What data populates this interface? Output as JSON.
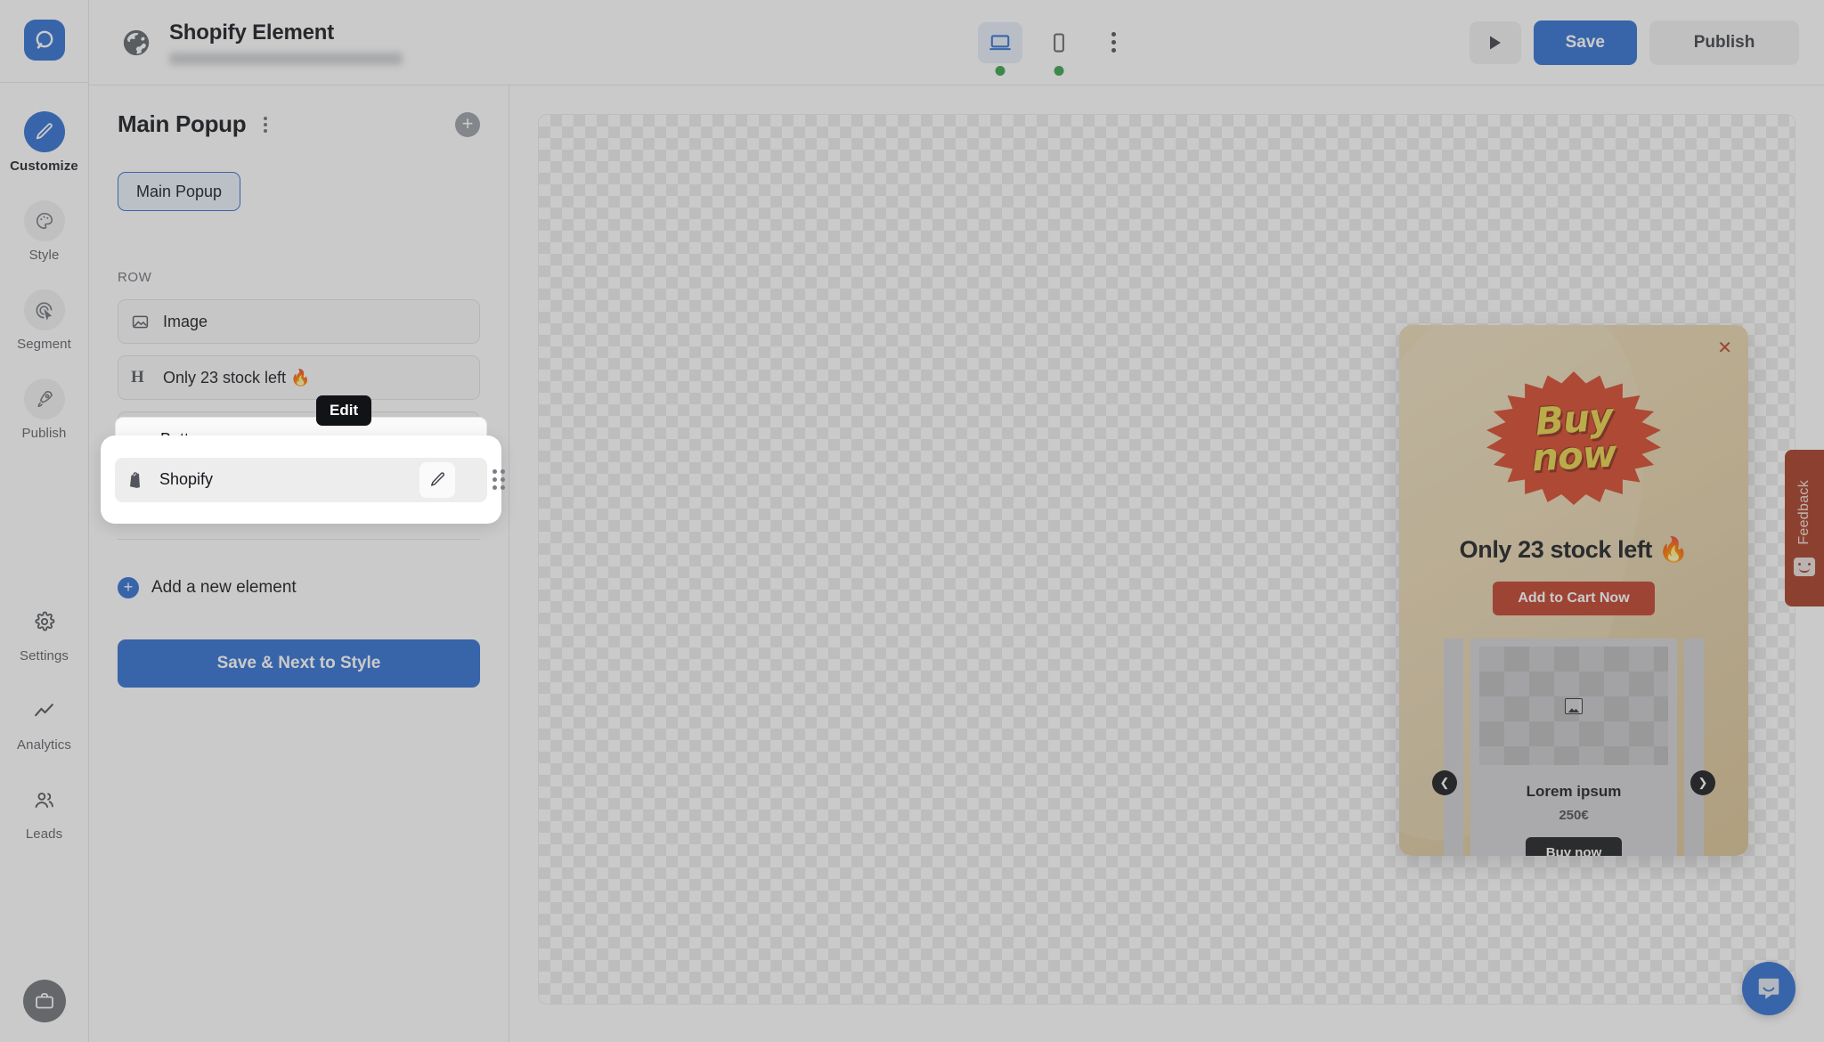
{
  "app": {
    "brand_color": "#2f6fd0",
    "logo_icon": "platform-logo-icon"
  },
  "rail": {
    "items": [
      {
        "label": "Customize",
        "icon": "pencil-icon",
        "active": true
      },
      {
        "label": "Style",
        "icon": "palette-icon",
        "active": false
      },
      {
        "label": "Segment",
        "icon": "target-cursor-icon",
        "active": false
      },
      {
        "label": "Publish",
        "icon": "rocket-icon",
        "active": false
      }
    ],
    "bottom_items": [
      {
        "label": "Settings",
        "icon": "gear-icon"
      },
      {
        "label": "Analytics",
        "icon": "line-chart-icon"
      },
      {
        "label": "Leads",
        "icon": "people-icon"
      }
    ],
    "avatar_icon": "briefcase-avatar-icon"
  },
  "topbar": {
    "globe_icon": "globe-icon",
    "title": "Shopify Element",
    "subtitle_redacted": true,
    "devices": [
      {
        "name": "desktop-view",
        "icon": "desktop-icon",
        "active": true,
        "status_dot": "#36a34a"
      },
      {
        "name": "mobile-view",
        "icon": "mobile-icon",
        "active": false,
        "status_dot": "#36a34a"
      }
    ],
    "more_icon": "kebab-menu-icon",
    "preview_icon": "play-icon",
    "save_label": "Save",
    "publish_label": "Publish"
  },
  "panel": {
    "title": "Main Popup",
    "kebab_icon": "kebab-menu-icon",
    "add_icon": "plus-circle-icon",
    "tab_label": "Main Popup",
    "section_label": "ROW",
    "elements": [
      {
        "label": "Image",
        "icon": "image-icon"
      },
      {
        "label": "Only 23 stock left 🔥",
        "icon": "heading-h-icon"
      },
      {
        "label": "Button",
        "icon": "button-icon"
      },
      {
        "label": "Shopify",
        "icon": "shopify-bag-icon"
      }
    ],
    "add_new_label": "Add a new element",
    "add_new_icon": "plus-circle-icon",
    "cta_label": "Save & Next to Style"
  },
  "spotlight": {
    "row_label": "Shopify",
    "row_icon": "shopify-bag-icon",
    "edit_icon": "pencil-edit-icon",
    "drag_icon": "drag-handle-icon",
    "tooltip_label": "Edit",
    "peek_row_label": "Button",
    "peek_row_icon": "button-icon"
  },
  "popup_preview": {
    "close_icon": "close-x-icon",
    "badge_line1": "Buy",
    "badge_line2": "now",
    "heading": "Only 23 stock left 🔥",
    "cta_label": "Add to Cart Now",
    "product": {
      "image_placeholder_icon": "image-placeholder-icon",
      "title": "Lorem ipsum",
      "price": "250€",
      "button_label": "Buy now"
    },
    "prev_icon": "chevron-left-icon",
    "next_icon": "chevron-right-icon",
    "colors": {
      "background": "#e6d2a9",
      "cta": "#c0402a",
      "badge": "#d6472a",
      "badge_text": "#e8d34a",
      "buy_now_button": "#1c1d1f"
    }
  },
  "feedback_tab": {
    "label": "Feedback",
    "icon": "smiley-face-icon",
    "color": "#a63c23"
  },
  "chat_widget": {
    "icon": "chat-bubble-icon",
    "color": "#2f6fd0"
  }
}
